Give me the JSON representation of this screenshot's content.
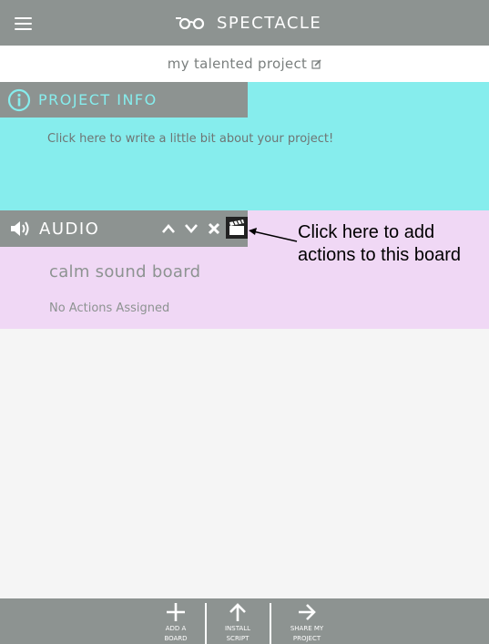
{
  "app": {
    "name": "SPECTACLE",
    "logo_icon": "spectacles-icon",
    "menu_icon": "hamburger-menu-icon"
  },
  "project": {
    "title": "my talented project",
    "edit_icon": "edit-icon"
  },
  "info": {
    "header": "PROJECT INFO",
    "icon": "info-icon",
    "placeholder": "Click here to write a little bit about your project!"
  },
  "board": {
    "type_label": "AUDIO",
    "type_icon": "speaker-icon",
    "controls": [
      "move-up-icon",
      "move-down-icon",
      "delete-icon",
      "clapperboard-icon"
    ],
    "name": "calm sound board",
    "actions_status": "No Actions Assigned"
  },
  "callout": {
    "text": "Click here to add actions to this board"
  },
  "bottom_nav": [
    {
      "icon": "plus-icon",
      "line1": "ADD A",
      "line2": "BOARD"
    },
    {
      "icon": "arrow-up-icon",
      "line1": "INSTALL",
      "line2": "SCRIPT"
    },
    {
      "icon": "arrow-right-icon",
      "line1": "SHARE MY",
      "line2": "PROJECT"
    }
  ],
  "colors": {
    "bar_gray": "#8d9391",
    "info_cyan": "#86eded",
    "audio_lavender": "#f0d8f5",
    "background": "#f5f5f5"
  }
}
